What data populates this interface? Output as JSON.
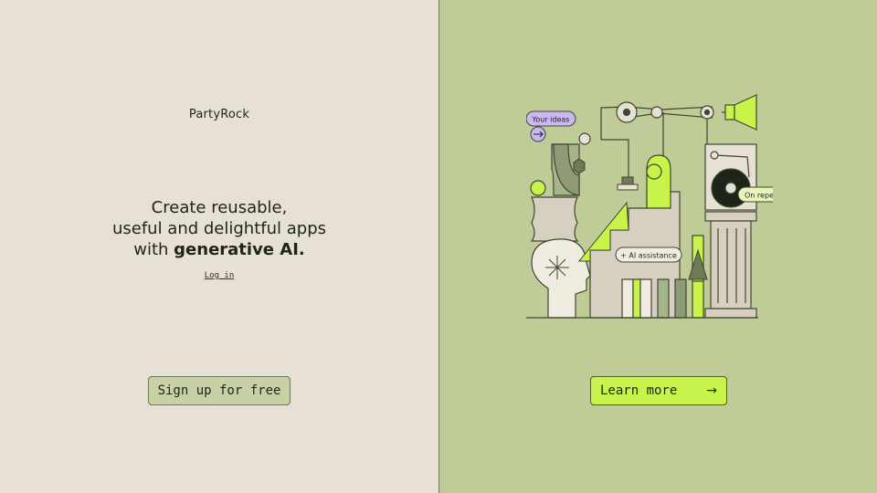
{
  "brand": {
    "name": "PartyRock"
  },
  "hero": {
    "line1": "Create reusable,",
    "line2": "useful and delightful apps",
    "line3_prefix": "with ",
    "line3_bold": "generative AI."
  },
  "auth": {
    "login_label": "Log in",
    "signup_label": "Sign up for free"
  },
  "cta": {
    "learn_more_label": "Learn more",
    "arrow": "→"
  },
  "illustration": {
    "tag_ideas": "Your ideas",
    "tag_ai": "+ AI assistance",
    "tag_repeat": "On repeat"
  },
  "colors": {
    "left_bg": "#e7e1d5",
    "right_bg": "#bfcc98",
    "accent": "#c8f34a"
  }
}
